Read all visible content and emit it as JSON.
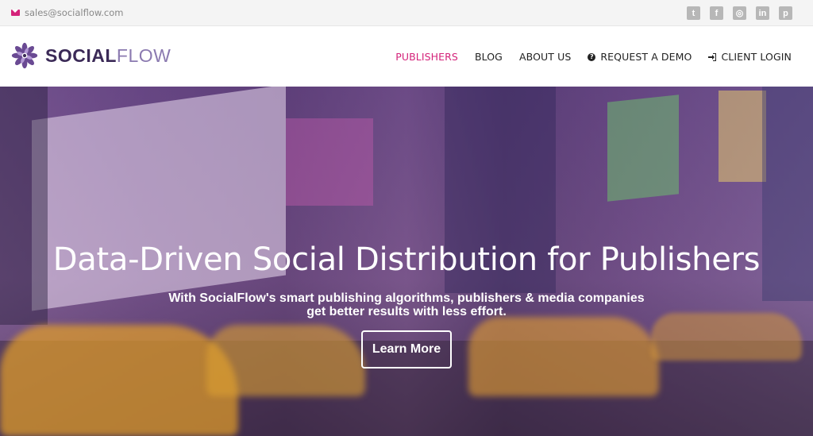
{
  "topbar": {
    "email": "sales@socialflow.com",
    "socials": [
      {
        "icon": "twitter-icon",
        "glyph": "t"
      },
      {
        "icon": "facebook-icon",
        "glyph": "f"
      },
      {
        "icon": "instagram-icon",
        "glyph": "◎"
      },
      {
        "icon": "linkedin-icon",
        "glyph": "in"
      },
      {
        "icon": "pinterest-icon",
        "glyph": "p"
      }
    ]
  },
  "header": {
    "logo_social": "SOCIAL",
    "logo_flow": "FLOW",
    "nav": [
      {
        "label": "PUBLISHERS",
        "active": true
      },
      {
        "label": "BLOG"
      },
      {
        "label": "ABOUT US"
      },
      {
        "label": "REQUEST A DEMO",
        "icon": "question-circle-icon"
      },
      {
        "label": "CLIENT LOGIN",
        "icon": "sign-in-icon"
      }
    ]
  },
  "hero": {
    "headline": "Data-Driven Social Distribution for Publishers",
    "sub_line1": "With SocialFlow's smart publishing algorithms, publishers & media companies",
    "sub_line2": "get better results with less effort.",
    "cta": "Learn More"
  },
  "colors": {
    "accent": "#d4237a",
    "logo_dark": "#3b2a57",
    "logo_light": "#8b7ab0",
    "overlay": "#6d4f84"
  }
}
